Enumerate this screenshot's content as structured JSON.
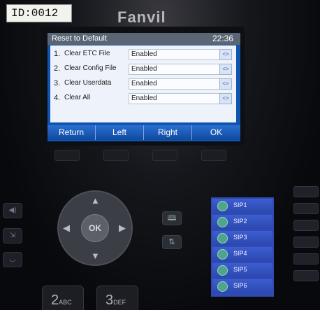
{
  "device": {
    "asset_tag": "ID:0012",
    "brand": "Fanvil"
  },
  "screen": {
    "title": "Reset to Default",
    "time": "22:36",
    "items": [
      {
        "num": "1.",
        "label": "Clear ETC File",
        "value": "Enabled",
        "switch_icon": "<>"
      },
      {
        "num": "2.",
        "label": "Clear Config File",
        "value": "Enabled",
        "switch_icon": "<>"
      },
      {
        "num": "3.",
        "label": "Clear Userdata",
        "value": "Enabled",
        "switch_icon": "<>"
      },
      {
        "num": "4.",
        "label": "Clear All",
        "value": "Enabled",
        "switch_icon": "<>"
      }
    ],
    "softkeys": [
      "Return",
      "Left",
      "Right",
      "OK"
    ]
  },
  "nav": {
    "ok_label": "OK"
  },
  "side_keys": {
    "phonebook_icon": "book-icon",
    "transfer_icon": "transfer-icon",
    "phonebook_glyph": "🕮",
    "transfer_glyph": "⇅"
  },
  "lines": [
    "SIP1",
    "SIP2",
    "SIP3",
    "SIP4",
    "SIP5",
    "SIP6"
  ],
  "keypad": {
    "key2": "2",
    "key2_sub": "ABC",
    "key3": "3",
    "key3_sub": "DEF"
  },
  "colors": {
    "screen_blue": "#0f55b0",
    "titlebar": "#5a6674",
    "line_panel": "#2f4bb3"
  }
}
